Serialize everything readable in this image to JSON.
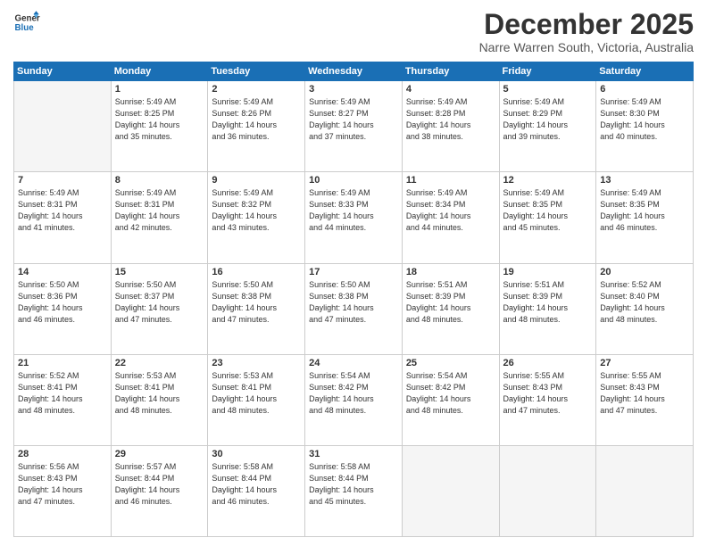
{
  "logo": {
    "line1": "General",
    "line2": "Blue"
  },
  "title": "December 2025",
  "location": "Narre Warren South, Victoria, Australia",
  "days_header": [
    "Sunday",
    "Monday",
    "Tuesday",
    "Wednesday",
    "Thursday",
    "Friday",
    "Saturday"
  ],
  "weeks": [
    [
      {
        "num": "",
        "empty": true
      },
      {
        "num": "1",
        "sunrise": "Sunrise: 5:49 AM",
        "sunset": "Sunset: 8:25 PM",
        "daylight": "Daylight: 14 hours and 35 minutes."
      },
      {
        "num": "2",
        "sunrise": "Sunrise: 5:49 AM",
        "sunset": "Sunset: 8:26 PM",
        "daylight": "Daylight: 14 hours and 36 minutes."
      },
      {
        "num": "3",
        "sunrise": "Sunrise: 5:49 AM",
        "sunset": "Sunset: 8:27 PM",
        "daylight": "Daylight: 14 hours and 37 minutes."
      },
      {
        "num": "4",
        "sunrise": "Sunrise: 5:49 AM",
        "sunset": "Sunset: 8:28 PM",
        "daylight": "Daylight: 14 hours and 38 minutes."
      },
      {
        "num": "5",
        "sunrise": "Sunrise: 5:49 AM",
        "sunset": "Sunset: 8:29 PM",
        "daylight": "Daylight: 14 hours and 39 minutes."
      },
      {
        "num": "6",
        "sunrise": "Sunrise: 5:49 AM",
        "sunset": "Sunset: 8:30 PM",
        "daylight": "Daylight: 14 hours and 40 minutes."
      }
    ],
    [
      {
        "num": "7",
        "sunrise": "Sunrise: 5:49 AM",
        "sunset": "Sunset: 8:31 PM",
        "daylight": "Daylight: 14 hours and 41 minutes."
      },
      {
        "num": "8",
        "sunrise": "Sunrise: 5:49 AM",
        "sunset": "Sunset: 8:31 PM",
        "daylight": "Daylight: 14 hours and 42 minutes."
      },
      {
        "num": "9",
        "sunrise": "Sunrise: 5:49 AM",
        "sunset": "Sunset: 8:32 PM",
        "daylight": "Daylight: 14 hours and 43 minutes."
      },
      {
        "num": "10",
        "sunrise": "Sunrise: 5:49 AM",
        "sunset": "Sunset: 8:33 PM",
        "daylight": "Daylight: 14 hours and 44 minutes."
      },
      {
        "num": "11",
        "sunrise": "Sunrise: 5:49 AM",
        "sunset": "Sunset: 8:34 PM",
        "daylight": "Daylight: 14 hours and 44 minutes."
      },
      {
        "num": "12",
        "sunrise": "Sunrise: 5:49 AM",
        "sunset": "Sunset: 8:35 PM",
        "daylight": "Daylight: 14 hours and 45 minutes."
      },
      {
        "num": "13",
        "sunrise": "Sunrise: 5:49 AM",
        "sunset": "Sunset: 8:35 PM",
        "daylight": "Daylight: 14 hours and 46 minutes."
      }
    ],
    [
      {
        "num": "14",
        "sunrise": "Sunrise: 5:50 AM",
        "sunset": "Sunset: 8:36 PM",
        "daylight": "Daylight: 14 hours and 46 minutes."
      },
      {
        "num": "15",
        "sunrise": "Sunrise: 5:50 AM",
        "sunset": "Sunset: 8:37 PM",
        "daylight": "Daylight: 14 hours and 47 minutes."
      },
      {
        "num": "16",
        "sunrise": "Sunrise: 5:50 AM",
        "sunset": "Sunset: 8:38 PM",
        "daylight": "Daylight: 14 hours and 47 minutes."
      },
      {
        "num": "17",
        "sunrise": "Sunrise: 5:50 AM",
        "sunset": "Sunset: 8:38 PM",
        "daylight": "Daylight: 14 hours and 47 minutes."
      },
      {
        "num": "18",
        "sunrise": "Sunrise: 5:51 AM",
        "sunset": "Sunset: 8:39 PM",
        "daylight": "Daylight: 14 hours and 48 minutes."
      },
      {
        "num": "19",
        "sunrise": "Sunrise: 5:51 AM",
        "sunset": "Sunset: 8:39 PM",
        "daylight": "Daylight: 14 hours and 48 minutes."
      },
      {
        "num": "20",
        "sunrise": "Sunrise: 5:52 AM",
        "sunset": "Sunset: 8:40 PM",
        "daylight": "Daylight: 14 hours and 48 minutes."
      }
    ],
    [
      {
        "num": "21",
        "sunrise": "Sunrise: 5:52 AM",
        "sunset": "Sunset: 8:41 PM",
        "daylight": "Daylight: 14 hours and 48 minutes."
      },
      {
        "num": "22",
        "sunrise": "Sunrise: 5:53 AM",
        "sunset": "Sunset: 8:41 PM",
        "daylight": "Daylight: 14 hours and 48 minutes."
      },
      {
        "num": "23",
        "sunrise": "Sunrise: 5:53 AM",
        "sunset": "Sunset: 8:41 PM",
        "daylight": "Daylight: 14 hours and 48 minutes."
      },
      {
        "num": "24",
        "sunrise": "Sunrise: 5:54 AM",
        "sunset": "Sunset: 8:42 PM",
        "daylight": "Daylight: 14 hours and 48 minutes."
      },
      {
        "num": "25",
        "sunrise": "Sunrise: 5:54 AM",
        "sunset": "Sunset: 8:42 PM",
        "daylight": "Daylight: 14 hours and 48 minutes."
      },
      {
        "num": "26",
        "sunrise": "Sunrise: 5:55 AM",
        "sunset": "Sunset: 8:43 PM",
        "daylight": "Daylight: 14 hours and 47 minutes."
      },
      {
        "num": "27",
        "sunrise": "Sunrise: 5:55 AM",
        "sunset": "Sunset: 8:43 PM",
        "daylight": "Daylight: 14 hours and 47 minutes."
      }
    ],
    [
      {
        "num": "28",
        "sunrise": "Sunrise: 5:56 AM",
        "sunset": "Sunset: 8:43 PM",
        "daylight": "Daylight: 14 hours and 47 minutes."
      },
      {
        "num": "29",
        "sunrise": "Sunrise: 5:57 AM",
        "sunset": "Sunset: 8:44 PM",
        "daylight": "Daylight: 14 hours and 46 minutes."
      },
      {
        "num": "30",
        "sunrise": "Sunrise: 5:58 AM",
        "sunset": "Sunset: 8:44 PM",
        "daylight": "Daylight: 14 hours and 46 minutes."
      },
      {
        "num": "31",
        "sunrise": "Sunrise: 5:58 AM",
        "sunset": "Sunset: 8:44 PM",
        "daylight": "Daylight: 14 hours and 45 minutes."
      },
      {
        "num": "",
        "empty": true
      },
      {
        "num": "",
        "empty": true
      },
      {
        "num": "",
        "empty": true
      }
    ]
  ]
}
